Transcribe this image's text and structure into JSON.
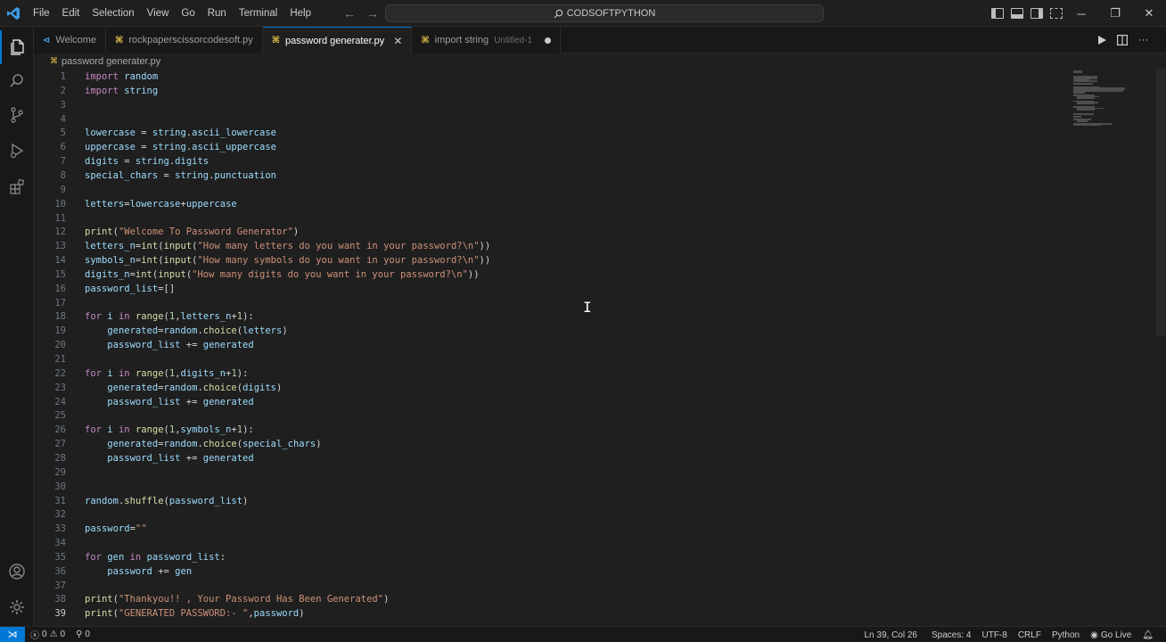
{
  "menu": [
    "File",
    "Edit",
    "Selection",
    "View",
    "Go",
    "Run",
    "Terminal",
    "Help"
  ],
  "search": {
    "label": "CODSOFTPYTHON"
  },
  "tabs": [
    {
      "label": "Welcome",
      "sub": ""
    },
    {
      "label": "rockpaperscissorcodesoft.py",
      "sub": ""
    },
    {
      "label": "password generater.py",
      "sub": ""
    },
    {
      "label": "import string",
      "sub": "Untitled-1"
    }
  ],
  "breadcrumb": {
    "file": "password generater.py"
  },
  "code_lines": [
    "import random",
    "import string",
    "",
    "",
    "lowercase = string.ascii_lowercase",
    "uppercase = string.ascii_uppercase",
    "digits = string.digits",
    "special_chars = string.punctuation",
    "",
    "letters=lowercase+uppercase",
    "",
    "print(\"Welcome To Password Generator\")",
    "letters_n=int(input(\"How many letters do you want in your password?\\n\"))",
    "symbols_n=int(input(\"How many symbols do you want in your password?\\n\"))",
    "digits_n=int(input(\"How many digits do you want in your password?\\n\"))",
    "password_list=[]",
    "",
    "for i in range(1,letters_n+1):",
    "    generated=random.choice(letters)",
    "    password_list += generated",
    "",
    "for i in range(1,digits_n+1):",
    "    generated=random.choice(digits)",
    "    password_list += generated",
    "",
    "for i in range(1,symbols_n+1):",
    "    generated=random.choice(special_chars)",
    "    password_list += generated",
    "",
    "",
    "random.shuffle(password_list)",
    "",
    "password=\"\"",
    "",
    "for gen in password_list:",
    "    password += gen",
    "",
    "print(\"Thankyou!! , Your Password Has Been Generated\")",
    "print(\"GENERATED PASSWORD:- \",password)"
  ],
  "status": {
    "errors": "0",
    "warnings": "0",
    "ports": "0",
    "position": "Ln 39, Col 26",
    "spaces": "Spaces: 4",
    "encoding": "UTF-8",
    "eol": "CRLF",
    "language": "Python",
    "golive": "Go Live"
  },
  "colors": {
    "accent": "#0078d4",
    "keyword": "#c586c0",
    "function": "#dcdcaa",
    "string": "#ce9178"
  }
}
